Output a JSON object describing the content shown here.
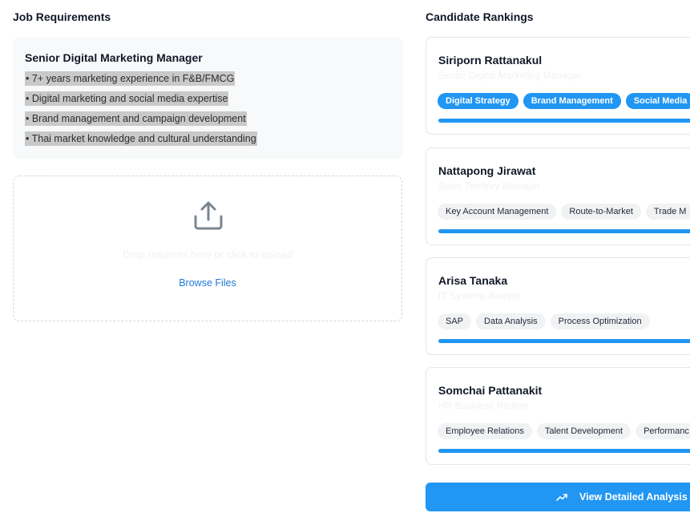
{
  "job_requirements": {
    "heading": "Job Requirements",
    "position_title": "Senior Digital Marketing Manager",
    "items": [
      "• 7+ years marketing experience in F&B/FMCG",
      "• Digital marketing and social media expertise",
      "• Brand management and campaign development",
      "• Thai market knowledge and cultural understanding"
    ]
  },
  "upload": {
    "prompt": "Drop resumes here or click to upload",
    "browse_label": "Browse Files",
    "icon": "upload-icon"
  },
  "rankings": {
    "heading": "Candidate Rankings",
    "candidates": [
      {
        "name": "Siriporn Rattanakul",
        "role": "Senior Digital Marketing Manager",
        "tags": [
          "Digital Strategy",
          "Brand Management",
          "Social Media"
        ],
        "match": 1.0
      },
      {
        "name": "Nattapong Jirawat",
        "role": "Sales Territory Manager",
        "tags": [
          "Key Account Management",
          "Route-to-Market",
          "Trade M"
        ],
        "match": 1.0
      },
      {
        "name": "Arisa Tanaka",
        "role": "IT Systems Analyst",
        "tags": [
          "SAP",
          "Data Analysis",
          "Process Optimization"
        ],
        "match": 1.0
      },
      {
        "name": "Somchai Pattanakit",
        "role": "HR Business Partner",
        "tags": [
          "Employee Relations",
          "Talent Development",
          "Performanc"
        ],
        "match": 1.0
      }
    ]
  },
  "actions": {
    "analysis_label": "View Detailed Analysis",
    "analysis_icon": "trending-up-icon"
  },
  "colors": {
    "accent": "#2196f3",
    "link": "#1f7ad8",
    "highlight": "#c9c9c9"
  }
}
